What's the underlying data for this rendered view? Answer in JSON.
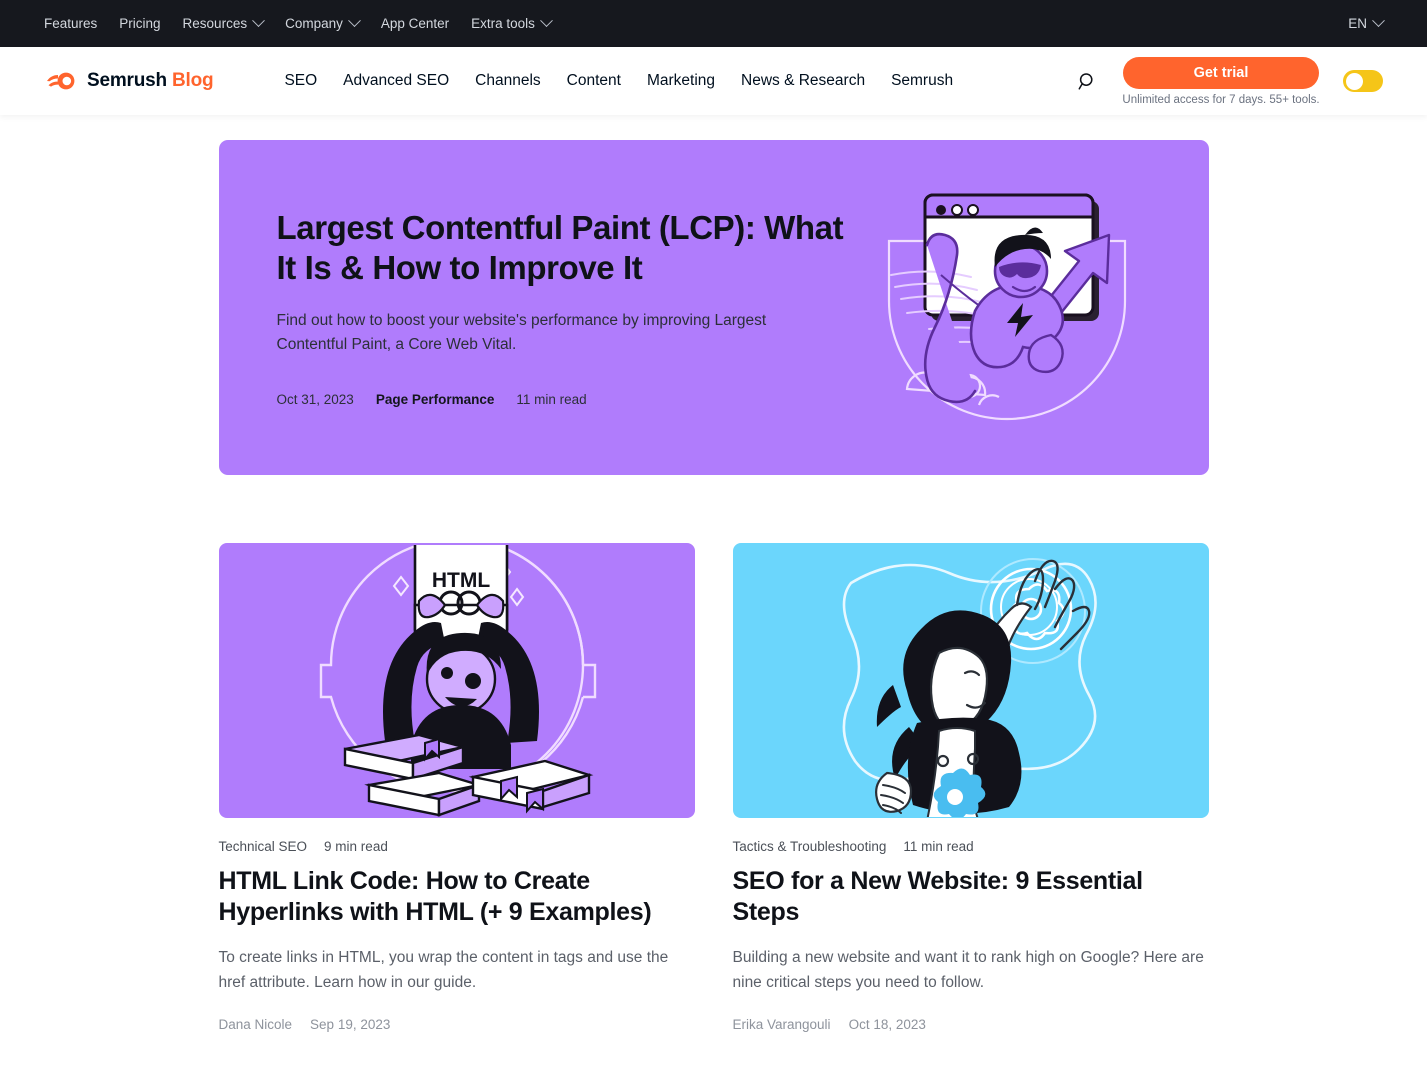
{
  "topbar": {
    "items": [
      {
        "label": "Features",
        "has_chevron": false
      },
      {
        "label": "Pricing",
        "has_chevron": false
      },
      {
        "label": "Resources",
        "has_chevron": true
      },
      {
        "label": "Company",
        "has_chevron": true
      },
      {
        "label": "App Center",
        "has_chevron": false
      },
      {
        "label": "Extra tools",
        "has_chevron": true
      }
    ],
    "language": "EN"
  },
  "header": {
    "brand_name": "Semrush",
    "brand_suffix": "Blog",
    "nav": [
      {
        "label": "SEO"
      },
      {
        "label": "Advanced SEO"
      },
      {
        "label": "Channels"
      },
      {
        "label": "Content"
      },
      {
        "label": "Marketing"
      },
      {
        "label": "News & Research"
      },
      {
        "label": "Semrush"
      }
    ],
    "search_icon": "search-icon",
    "cta_label": "Get trial",
    "cta_sub": "Unlimited access for 7 days. 55+ tools.",
    "theme_toggle_state": "off"
  },
  "hero": {
    "title": "Largest Contentful Paint (LCP): What It Is & How to Improve It",
    "description": "Find out how to boost your website's performance by improving Largest Contentful Paint, a Core Web Vital.",
    "date": "Oct 31, 2023",
    "category": "Page Performance",
    "read_time": "11 min read",
    "background_color": "#b07cfc",
    "illustration": "superhero-flying-out-of-browser-window-illustration"
  },
  "cards": [
    {
      "category": "Technical SEO",
      "read_time": "9 min read",
      "title": "HTML Link Code: How to Create Hyperlinks with HTML (+ 9 Examples)",
      "description": "To create links in HTML, you wrap the content in tags and use the href attribute. Learn how in our guide.",
      "author": "Dana Nicole",
      "date": "Sep 19, 2023",
      "background_color": "#b07cfc",
      "illustration": "person-holding-html-page-above-books-illustration",
      "illustration_label": "HTML"
    },
    {
      "category": "Tactics & Troubleshooting",
      "read_time": "11 min read",
      "title": "SEO for a New Website: 9 Essential Steps",
      "description": "Building a new website and want it to rank high on Google? Here are nine critical steps you need to follow.",
      "author": "Erika Varangouli",
      "date": "Oct 18, 2023",
      "background_color": "#6bd6fc",
      "illustration": "woman-reaching-for-glowing-gear-orb-illustration"
    }
  ],
  "colors": {
    "accent_orange": "#ff642d",
    "topbar_dark": "#16181e",
    "purple": "#b07cfc",
    "cyan": "#6bd6fc",
    "toggle_yellow": "#f5c518"
  }
}
